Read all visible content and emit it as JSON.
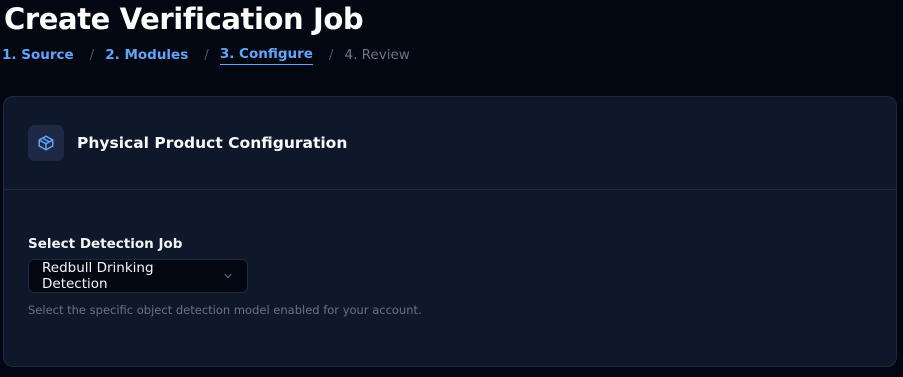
{
  "page": {
    "title": "Create Verification Job"
  },
  "steps": [
    {
      "label": "1. Source",
      "state": "complete"
    },
    {
      "label": "2. Modules",
      "state": "complete"
    },
    {
      "label": "3. Configure",
      "state": "active"
    },
    {
      "label": "4. Review",
      "state": "upcoming"
    }
  ],
  "breadcrumb_separator": "/",
  "card": {
    "icon": "package-icon",
    "title": "Physical Product Configuration"
  },
  "detection_field": {
    "label": "Select Detection Job",
    "selected_value": "Redbull Drinking Detection",
    "helper": "Select the specific object detection model enabled for your account."
  },
  "colors": {
    "background": "#030712",
    "card": "#0f172a",
    "accent": "#60a5fa",
    "muted": "#6b7280"
  }
}
